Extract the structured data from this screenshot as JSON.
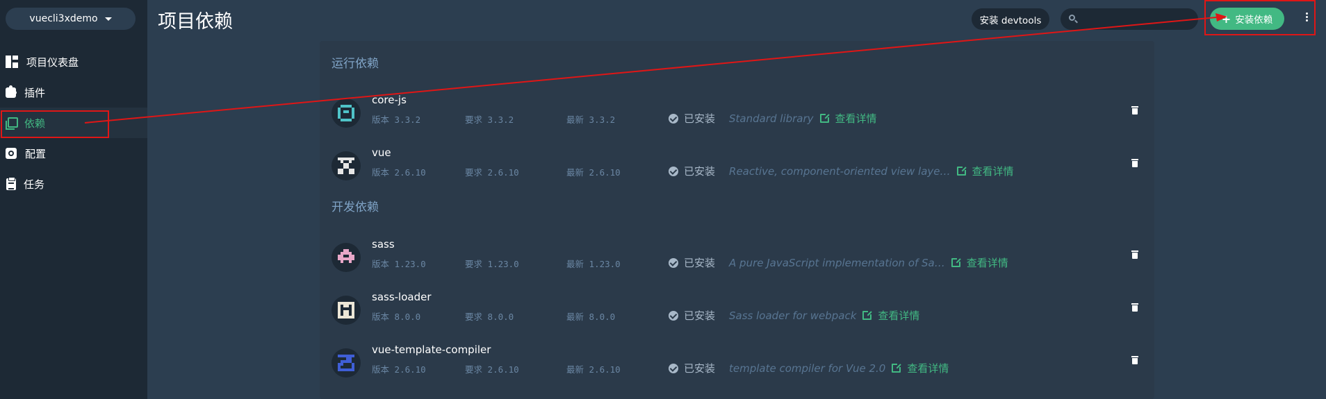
{
  "app": {
    "project_name": "vuecli3xdemo",
    "page_title": "项目依赖"
  },
  "sidebar": {
    "items": [
      {
        "label": "项目仪表盘",
        "icon": "dashboard-icon",
        "active": false
      },
      {
        "label": "插件",
        "icon": "puzzle-icon",
        "active": false
      },
      {
        "label": "依赖",
        "icon": "library-books-icon",
        "active": true
      },
      {
        "label": "配置",
        "icon": "settings-applications-icon",
        "active": false
      },
      {
        "label": "任务",
        "icon": "assignment-icon",
        "active": false
      }
    ]
  },
  "header": {
    "devtools_label": "安装 devtools",
    "search_placeholder": "",
    "search_value": "",
    "install_label": "安装依赖",
    "more_icon": "more-vertical-icon"
  },
  "sections": [
    {
      "title": "运行依赖",
      "deps": [
        {
          "name": "core-js",
          "version_label": "版本",
          "version": "3.3.2",
          "wanted_label": "要求",
          "wanted": "3.3.2",
          "latest_label": "最新",
          "latest": "3.3.2",
          "status": "已安装",
          "description": "Standard library",
          "detail_link": "查看详情",
          "avatar_color": "#4fc3c8"
        },
        {
          "name": "vue",
          "version_label": "版本",
          "version": "2.6.10",
          "wanted_label": "要求",
          "wanted": "2.6.10",
          "latest_label": "最新",
          "latest": "2.6.10",
          "status": "已安装",
          "description": "Reactive, component-oriented view laye…",
          "detail_link": "查看详情",
          "avatar_color": "#e6e6e6"
        }
      ]
    },
    {
      "title": "开发依赖",
      "deps": [
        {
          "name": "sass",
          "version_label": "版本",
          "version": "1.23.0",
          "wanted_label": "要求",
          "wanted": "1.23.0",
          "latest_label": "最新",
          "latest": "1.23.0",
          "status": "已安装",
          "description": "A pure JavaScript implementation of Sa…",
          "detail_link": "查看详情",
          "avatar_color": "#e8a7c8"
        },
        {
          "name": "sass-loader",
          "version_label": "版本",
          "version": "8.0.0",
          "wanted_label": "要求",
          "wanted": "8.0.0",
          "latest_label": "最新",
          "latest": "8.0.0",
          "status": "已安装",
          "description": "Sass loader for webpack",
          "detail_link": "查看详情",
          "avatar_color": "#ece6d6"
        },
        {
          "name": "vue-template-compiler",
          "version_label": "版本",
          "version": "2.6.10",
          "wanted_label": "要求",
          "wanted": "2.6.10",
          "latest_label": "最新",
          "latest": "2.6.10",
          "status": "已安装",
          "description": "template compiler for Vue 2.0",
          "detail_link": "查看详情",
          "avatar_color": "#3f5ed6"
        }
      ]
    }
  ],
  "colors": {
    "accent": "#42b983",
    "annotation": "#e01616"
  }
}
